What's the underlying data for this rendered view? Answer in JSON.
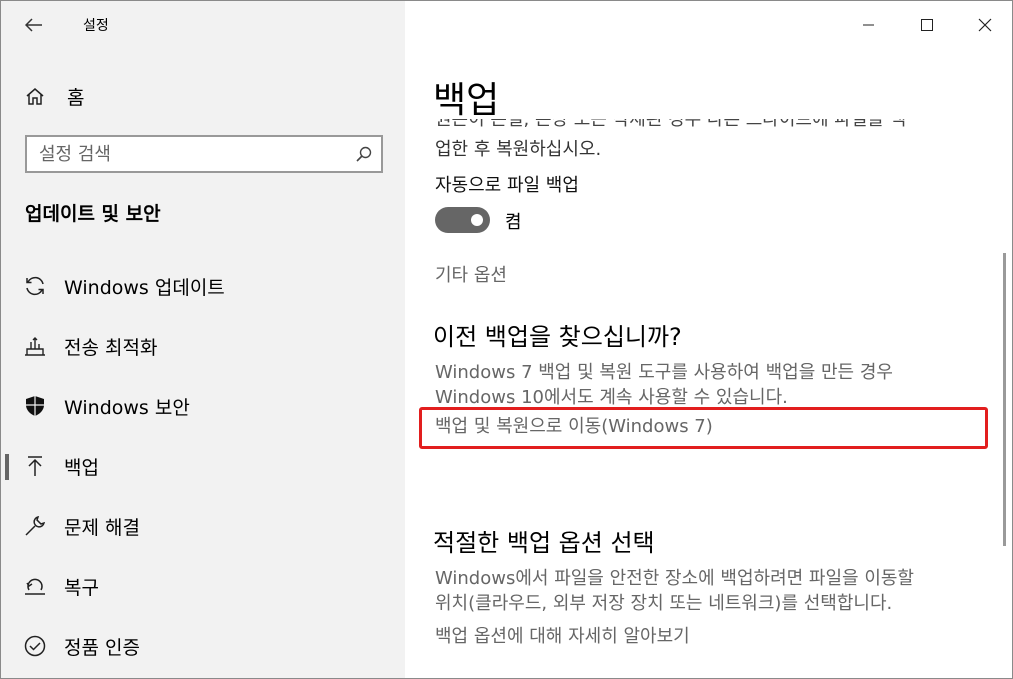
{
  "window": {
    "title": "설정",
    "controls": [
      "minimize-icon",
      "maximize-icon",
      "close-icon"
    ]
  },
  "sidebar": {
    "home_label": "홈",
    "search_placeholder": "설정 검색",
    "section_title": "업데이트 및 보안",
    "items": [
      {
        "label": "Windows 업데이트",
        "icon": "refresh-icon"
      },
      {
        "label": "전송 최적화",
        "icon": "delivery-optimization-icon"
      },
      {
        "label": "Windows 보안",
        "icon": "shield-icon"
      },
      {
        "label": "백업",
        "icon": "backup-arrow-icon",
        "active": true
      },
      {
        "label": "문제 해결",
        "icon": "wrench-icon"
      },
      {
        "label": "복구",
        "icon": "recovery-icon"
      },
      {
        "label": "정품 인증",
        "icon": "check-circle-icon"
      }
    ]
  },
  "main": {
    "page_title": "백업",
    "clipped_line": "원본이 손실, 손상 또는 삭제된 경우 다른 드라이브에 파일을 백",
    "restore_line": "업한 후 복원하십시오.",
    "auto_backup_label": "자동으로 파일 백업",
    "toggle_state": "켬",
    "more_options_link": "기타 옵션",
    "older_backup_heading": "이전 백업을 찾으십니까?",
    "older_backup_text": [
      "Windows 7 백업 및 복원 도구를 사용하여 백업을 만든 경우",
      "Windows 10에서도 계속 사용할 수 있습니다."
    ],
    "go_to_backup_link": "백업 및 복원으로 이동(Windows 7)",
    "choose_heading": "적절한 백업 옵션 선택",
    "choose_text": [
      "Windows에서 파일을 안전한 장소에 백업하려면 파일을 이동할",
      "위치(클라우드, 외부 저장 장치 또는 네트워크)를 선택합니다."
    ],
    "learn_more_link": "백업 옵션에 대해 자세히 알아보기"
  },
  "colors": {
    "sidebar_bg": "#f2f2f2",
    "highlight_box": "#e21e1e",
    "toggle_on": "#666666"
  }
}
